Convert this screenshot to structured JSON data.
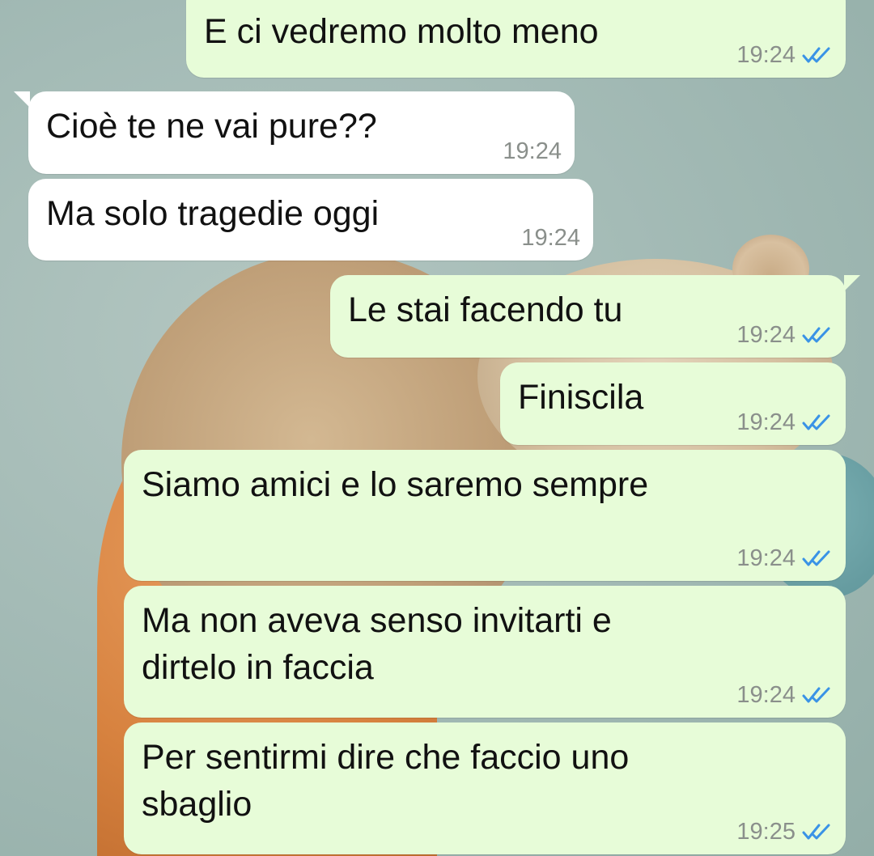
{
  "colors": {
    "outgoing_bubble": "#e7fcd8",
    "incoming_bubble": "#ffffff",
    "read_ticks": "#3a93e6",
    "time_text": "#8a8f8b"
  },
  "messages": [
    {
      "direction": "outgoing",
      "text": "E ci vedremo molto meno",
      "time": "19:24",
      "status_icon": "double-check-read-icon"
    },
    {
      "direction": "incoming",
      "text": "Cioè te ne vai pure??",
      "time": "19:24"
    },
    {
      "direction": "incoming",
      "text": "Ma solo tragedie oggi",
      "time": "19:24"
    },
    {
      "direction": "outgoing",
      "text": "Le stai facendo tu",
      "time": "19:24",
      "status_icon": "double-check-read-icon"
    },
    {
      "direction": "outgoing",
      "text": "Finiscila",
      "time": "19:24",
      "status_icon": "double-check-read-icon"
    },
    {
      "direction": "outgoing",
      "text": "Siamo amici e lo saremo sempre",
      "time": "19:24",
      "status_icon": "double-check-read-icon"
    },
    {
      "direction": "outgoing",
      "lines": [
        "Ma non aveva senso invitarti e",
        "dirtelo in faccia"
      ],
      "time": "19:24",
      "status_icon": "double-check-read-icon"
    },
    {
      "direction": "outgoing",
      "lines": [
        "Per sentirmi dire che faccio uno",
        "sbaglio"
      ],
      "time": "19:25",
      "status_icon": "double-check-read-icon"
    }
  ]
}
